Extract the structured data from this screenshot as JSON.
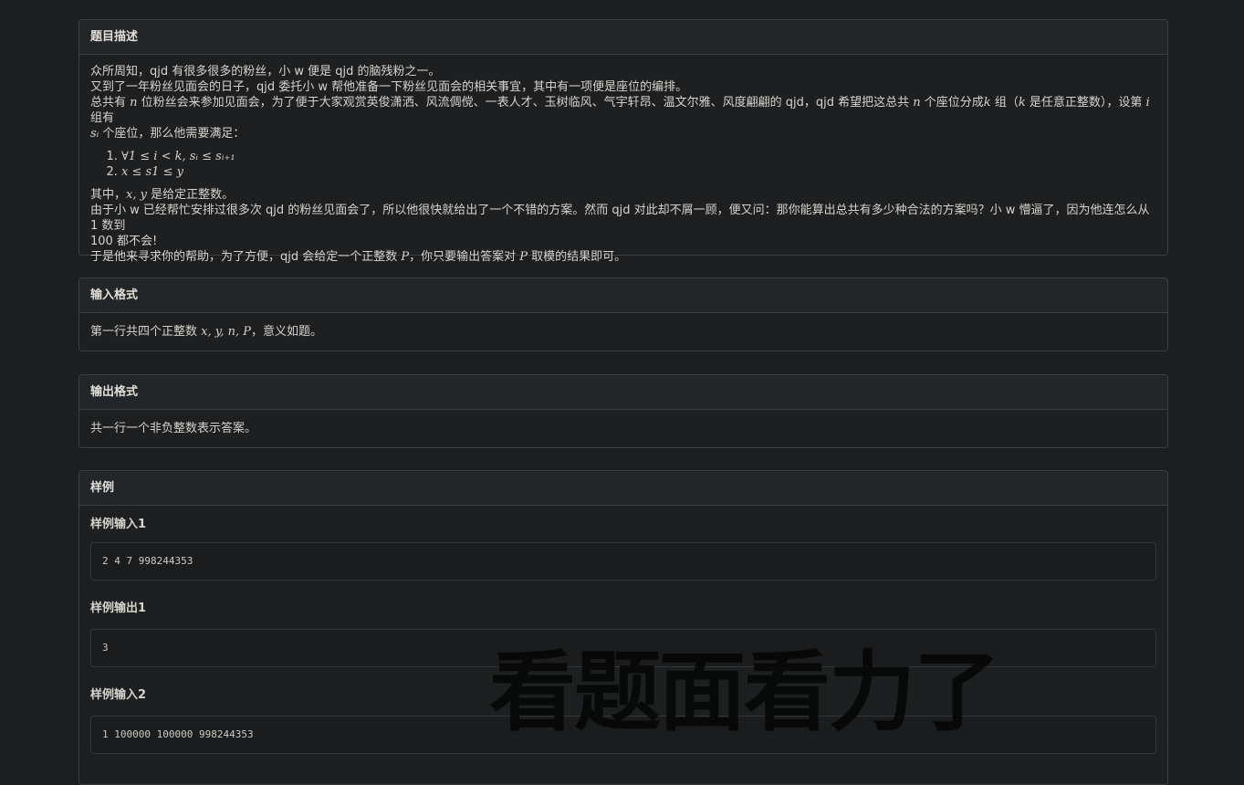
{
  "description": {
    "title": "题目描述",
    "line1": "众所周知，qjd 有很多很多的粉丝，小 w 便是 qjd 的脑残粉之一。",
    "line2": "又到了一年粉丝见面会的日子，qjd 委托小 w 帮他准备一下粉丝见面会的相关事宜，其中有一项便是座位的编排。",
    "line3_a": "总共有 ",
    "line3_n": "n",
    "line3_b": " 位粉丝会来参加见面会，为了便于大家观赏英俊潇洒、风流倜傥、一表人才、玉树临风、气宇轩昂、温文尔雅、风度翩翩的 qjd，qjd 希望把这总共 ",
    "line3_n2": "n",
    "line3_c": " 个座位分成",
    "line3_k": "k",
    "line3_d": " 组（",
    "line3_k2": "k",
    "line3_e": " 是任意正整数），设第 ",
    "line3_i": "i",
    "line3_f": " 组有",
    "line4_s": "sᵢ",
    "line4_a": " 个座位，那么他需要满足：",
    "cond1": "∀1 ≤ i < k, sᵢ ≤ sᵢ₊₁",
    "cond2": "x ≤ s1 ≤ y",
    "line5_a": "其中，",
    "line5_m": "x, y",
    "line5_b": " 是给定正整数。",
    "line6": "由于小 w 已经帮忙安排过很多次 qjd 的粉丝见面会了，所以他很快就给出了一个不错的方案。然而 qjd 对此却不屑一顾，便又问：那你能算出总共有多少种合法的方案吗？小 w 懵逼了，因为他连怎么从 1 数到",
    "line7": "100 都不会!",
    "line8_a": "于是他来寻求你的帮助，为了方便，qjd 会给定一个正整数 ",
    "line8_p": "P",
    "line8_b": "，你只要输出答案对 ",
    "line8_p2": "P",
    "line8_c": " 取模的结果即可。"
  },
  "input_format": {
    "title": "输入格式",
    "text_a": "第一行共四个正整数 ",
    "text_m": "x, y, n, P",
    "text_b": "，意义如题。"
  },
  "output_format": {
    "title": "输出格式",
    "text": "共一行一个非负整数表示答案。"
  },
  "samples": {
    "title": "样例",
    "items": [
      {
        "label": "样例输入1",
        "value": "2 4 7 998244353"
      },
      {
        "label": "样例输出1",
        "value": "3"
      },
      {
        "label": "样例输入2",
        "value": "1 100000 100000 998244353"
      }
    ]
  },
  "watermark": "看题面看力了"
}
